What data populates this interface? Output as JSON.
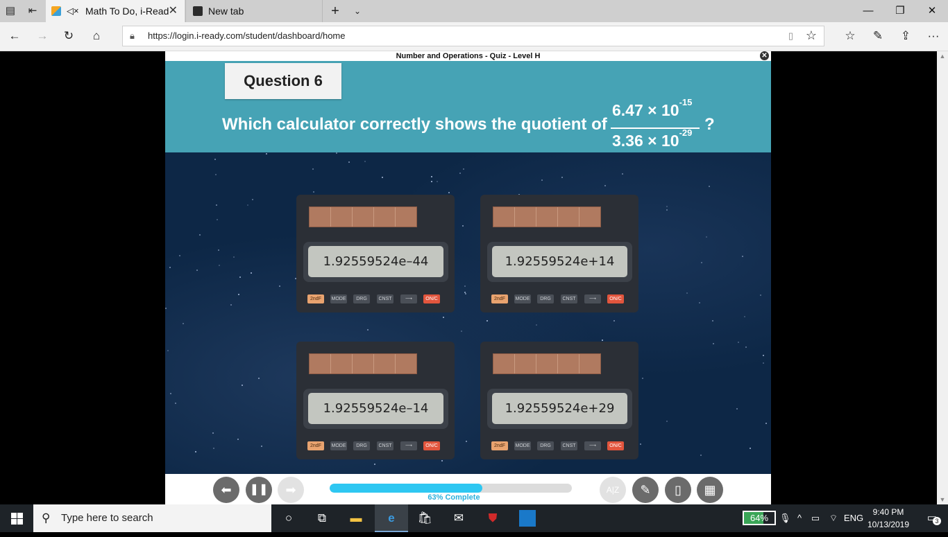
{
  "browser": {
    "tabs": [
      {
        "title": "Math To Do, i-Read",
        "active": true,
        "audio_icon": "speaker-muted-icon"
      },
      {
        "title": "New tab",
        "active": false
      }
    ],
    "url": "https://login.i-ready.com/student/dashboard/home",
    "icons": {
      "tab_actions": "tab-actions-icon",
      "set_aside": "set-aside-tabs-icon",
      "new_tab": "plus-icon",
      "tab_list": "chevron-down-icon",
      "minimize": "minimize-icon",
      "restore": "restore-icon",
      "close": "close-icon",
      "back": "arrow-left-icon",
      "forward": "arrow-right-icon",
      "refresh": "refresh-icon",
      "home": "home-icon",
      "lock": "lock-icon",
      "reading_view": "reading-view-icon",
      "favorite": "star-icon",
      "favorites": "favorites-icon",
      "notes": "pen-icon",
      "share": "share-icon",
      "more": "more-icon"
    }
  },
  "quiz": {
    "window_title": "Number and Operations - Quiz - Level H",
    "question_label": "Question 6",
    "question_text": "Which calculator correctly shows the quotient of",
    "numerator": {
      "base": "6.47 × 10",
      "exponent": "-15"
    },
    "denominator": {
      "base": "3.36 × 10",
      "exponent": "-29"
    },
    "question_end": "?",
    "calculators": [
      {
        "display": "1.92559524e–44"
      },
      {
        "display": "1.92559524e+14"
      },
      {
        "display": "1.92559524e–14"
      },
      {
        "display": "1.92559524e+29"
      }
    ],
    "keys": [
      "2ndF",
      "MODE",
      "DRG",
      "CNST",
      "⟶",
      "ON/C"
    ],
    "progress": {
      "percent": 63,
      "label": "63% Complete"
    },
    "controls": {
      "back": "arrow-left-icon",
      "pause": "pause-icon",
      "next": "arrow-right-icon",
      "glossary": "glossary-icon",
      "pencil": "pencil-icon",
      "notepad": "notepad-icon",
      "calculator": "calculator-icon"
    }
  },
  "taskbar": {
    "search_placeholder": "Type here to search",
    "battery": "64%",
    "battery_level": 0.64,
    "language": "ENG",
    "time": "9:40 PM",
    "date": "10/13/2019",
    "notifications": "3"
  },
  "colors": {
    "question_panel": "#46a3b5",
    "space_bg": "#0d2746",
    "progress_fill": "#2ec7f2",
    "calculator_body": "#2b2f36"
  }
}
